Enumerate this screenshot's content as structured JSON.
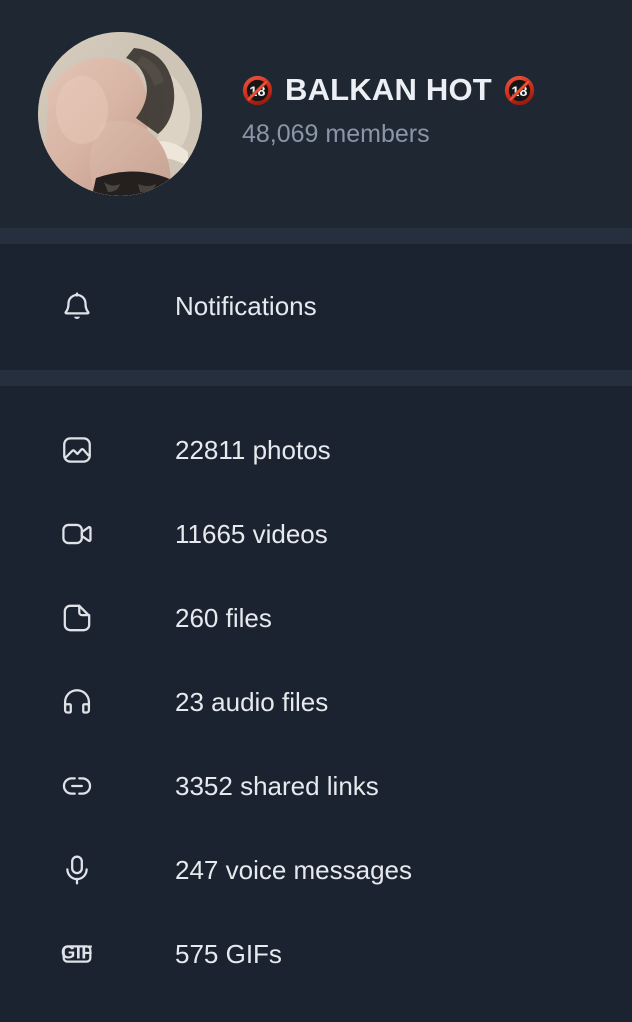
{
  "profile": {
    "avatar_alt": "group-avatar-photo",
    "title_prefix_icon": "no-under-18-badge",
    "title": "BALKAN HOT",
    "title_suffix_icon": "no-under-18-badge",
    "title_full": "🔞 BALKAN HOT 🔞",
    "members": "48,069 members"
  },
  "notifications": {
    "icon": "bell-icon",
    "label": "Notifications"
  },
  "media": {
    "items": [
      {
        "icon": "photo-icon",
        "label": "22811 photos"
      },
      {
        "icon": "video-icon",
        "label": "11665 videos"
      },
      {
        "icon": "file-icon",
        "label": "260 files"
      },
      {
        "icon": "headphones-icon",
        "label": "23 audio files"
      },
      {
        "icon": "link-icon",
        "label": "3352 shared links"
      },
      {
        "icon": "microphone-icon",
        "label": "247 voice messages"
      },
      {
        "icon": "gif-icon",
        "label": "575 GIFs"
      }
    ]
  },
  "colors": {
    "header_bg": "#1f2733",
    "panel_bg": "#1b2330",
    "divider": "#262f3d",
    "primary_text": "#e6e9ed",
    "secondary_text": "#8a96a8",
    "badge_red": "#d93025"
  }
}
